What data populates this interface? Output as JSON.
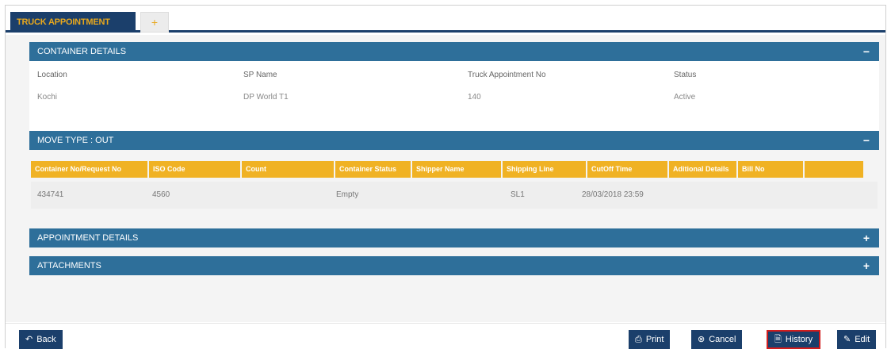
{
  "tabs": {
    "active_label": "TRUCK APPOINTMENT",
    "add_label": "+"
  },
  "container_details": {
    "title": "CONTAINER DETAILS",
    "toggle": "−",
    "fields": [
      {
        "label": "Location",
        "value": "Kochi"
      },
      {
        "label": "SP Name",
        "value": "DP World T1"
      },
      {
        "label": "Truck Appointment No",
        "value": "140"
      },
      {
        "label": "Status",
        "value": "Active"
      }
    ]
  },
  "move_type": {
    "title": "MOVE TYPE : OUT",
    "toggle": "−",
    "columns": [
      "Container No/Request No",
      "ISO Code",
      "Count",
      "Container Status",
      "Shipper Name",
      "Shipping Line",
      "CutOff Time",
      "Aditional Details",
      "Bill No",
      ""
    ],
    "rows": [
      [
        "434741",
        "4560",
        "",
        "Empty",
        "",
        "SL1",
        "28/03/2018 23:59",
        "",
        "",
        ""
      ]
    ]
  },
  "appointment_details": {
    "title": "APPOINTMENT DETAILS",
    "toggle": "+"
  },
  "attachments": {
    "title": "ATTACHMENTS",
    "toggle": "+"
  },
  "footer": {
    "back": "Back",
    "print": "Print",
    "cancel": "Cancel",
    "history": "History",
    "edit": "Edit"
  },
  "colors": {
    "navy": "#1b3f6b",
    "panel_blue": "#2e6f9a",
    "amber": "#f0b224",
    "highlight_red": "#d21d1d"
  }
}
